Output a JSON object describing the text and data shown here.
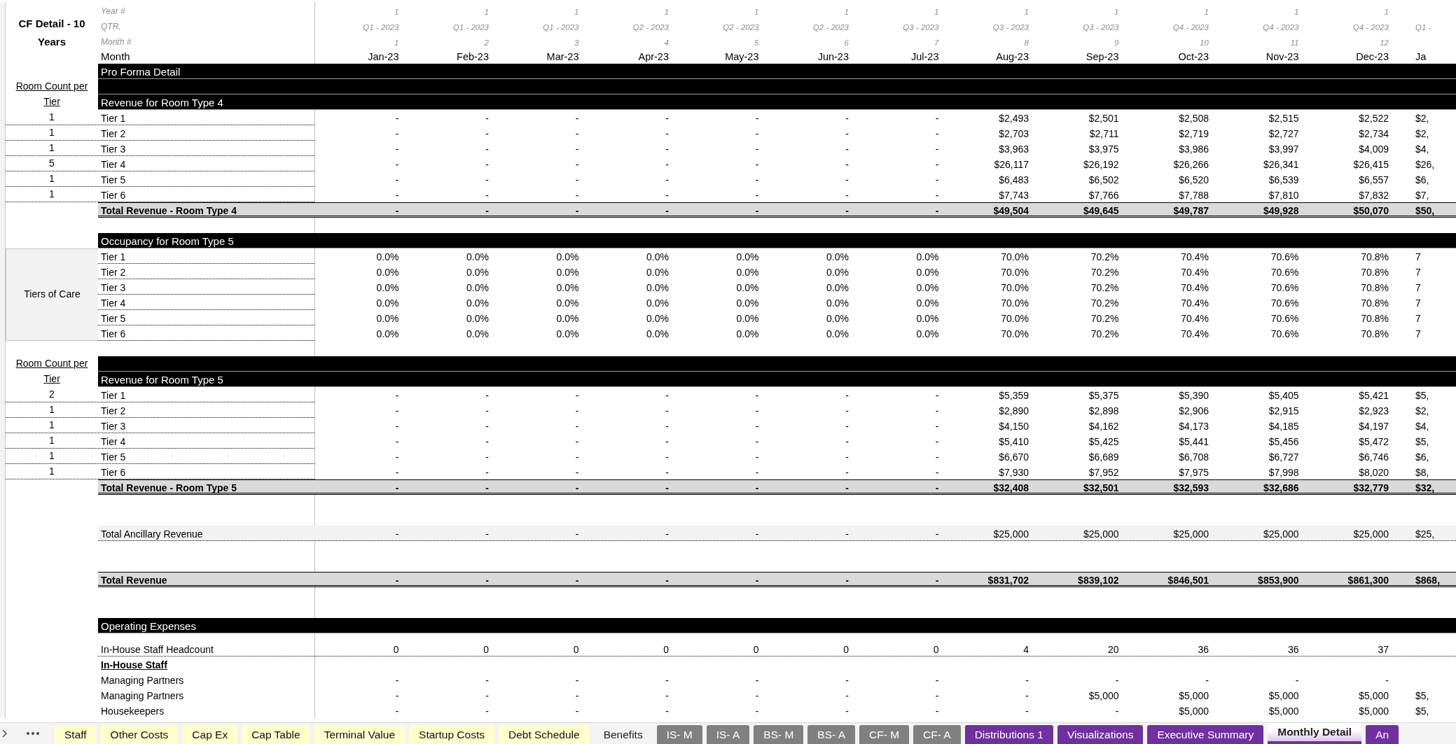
{
  "sheet": {
    "rows": [
      {
        "kind": "meta",
        "side": {
          "kind": "title",
          "text": "CF Detail - 10 Years"
        },
        "label": "Year #",
        "values": [
          "1",
          "1",
          "1",
          "1",
          "1",
          "1",
          "1",
          "1",
          "1",
          "1",
          "1",
          "1"
        ]
      },
      {
        "kind": "meta",
        "label": "QTR.",
        "values": [
          "Q1 - 2023",
          "Q1 - 2023",
          "Q1 - 2023",
          "Q2 - 2023",
          "Q2 - 2023",
          "Q2 - 2023",
          "Q3 - 2023",
          "Q3 - 2023",
          "Q3 - 2023",
          "Q4 - 2023",
          "Q4 - 2023",
          "Q4 - 2023",
          "Q1 -"
        ]
      },
      {
        "kind": "meta",
        "label": "Month #",
        "values": [
          "1",
          "2",
          "3",
          "4",
          "5",
          "6",
          "7",
          "8",
          "9",
          "10",
          "11",
          "12"
        ]
      },
      {
        "kind": "month",
        "label": "Month",
        "values": [
          "Jan-23",
          "Feb-23",
          "Mar-23",
          "Apr-23",
          "May-23",
          "Jun-23",
          "Jul-23",
          "Aug-23",
          "Sep-23",
          "Oct-23",
          "Nov-23",
          "Dec-23",
          "Ja"
        ]
      },
      {
        "kind": "band",
        "label": "Pro Forma Detail"
      },
      {
        "kind": "band",
        "side": {
          "kind": "heading",
          "text": "Room Count per Tier"
        }
      },
      {
        "kind": "band",
        "label": "Revenue for Room Type 4"
      },
      {
        "kind": "item",
        "side": {
          "kind": "count",
          "text": "1"
        },
        "label": "Tier 1",
        "values": [
          "-",
          "-",
          "-",
          "-",
          "-",
          "-",
          "-",
          "$2,493",
          "$2,501",
          "$2,508",
          "$2,515",
          "$2,522",
          "$2,"
        ]
      },
      {
        "kind": "item",
        "side": {
          "kind": "count",
          "text": "1"
        },
        "label": "Tier 2",
        "values": [
          "-",
          "-",
          "-",
          "-",
          "-",
          "-",
          "-",
          "$2,703",
          "$2,711",
          "$2,719",
          "$2,727",
          "$2,734",
          "$2,"
        ]
      },
      {
        "kind": "item",
        "side": {
          "kind": "count",
          "text": "1"
        },
        "label": "Tier 3",
        "values": [
          "-",
          "-",
          "-",
          "-",
          "-",
          "-",
          "-",
          "$3,963",
          "$3,975",
          "$3,986",
          "$3,997",
          "$4,009",
          "$4,"
        ]
      },
      {
        "kind": "item",
        "side": {
          "kind": "count",
          "text": "5"
        },
        "label": "Tier 4",
        "values": [
          "-",
          "-",
          "-",
          "-",
          "-",
          "-",
          "-",
          "$26,117",
          "$26,192",
          "$26,266",
          "$26,341",
          "$26,415",
          "$26,"
        ]
      },
      {
        "kind": "item",
        "side": {
          "kind": "count",
          "text": "1"
        },
        "label": "Tier 5",
        "values": [
          "-",
          "-",
          "-",
          "-",
          "-",
          "-",
          "-",
          "$6,483",
          "$6,502",
          "$6,520",
          "$6,539",
          "$6,557",
          "$6,"
        ]
      },
      {
        "kind": "item",
        "side": {
          "kind": "count",
          "text": "1"
        },
        "label": "Tier 6",
        "values": [
          "-",
          "-",
          "-",
          "-",
          "-",
          "-",
          "-",
          "$7,743",
          "$7,766",
          "$7,788",
          "$7,810",
          "$7,832",
          "$7,"
        ]
      },
      {
        "kind": "total",
        "label": "Total Revenue - Room Type 4",
        "values": [
          "-",
          "-",
          "-",
          "-",
          "-",
          "-",
          "-",
          "$49,504",
          "$49,645",
          "$49,787",
          "$49,928",
          "$50,070",
          "$50,"
        ]
      },
      {
        "kind": "blank"
      },
      {
        "kind": "band",
        "label": "Occupancy for Room Type 5"
      },
      {
        "kind": "item",
        "side": {
          "kind": "group",
          "text": "Tiers of Care"
        },
        "label": "Tier 1",
        "values": [
          "0.0%",
          "0.0%",
          "0.0%",
          "0.0%",
          "0.0%",
          "0.0%",
          "0.0%",
          "70.0%",
          "70.2%",
          "70.4%",
          "70.6%",
          "70.8%",
          "7"
        ]
      },
      {
        "kind": "item",
        "label": "Tier 2",
        "values": [
          "0.0%",
          "0.0%",
          "0.0%",
          "0.0%",
          "0.0%",
          "0.0%",
          "0.0%",
          "70.0%",
          "70.2%",
          "70.4%",
          "70.6%",
          "70.8%",
          "7"
        ]
      },
      {
        "kind": "item",
        "label": "Tier 3",
        "values": [
          "0.0%",
          "0.0%",
          "0.0%",
          "0.0%",
          "0.0%",
          "0.0%",
          "0.0%",
          "70.0%",
          "70.2%",
          "70.4%",
          "70.6%",
          "70.8%",
          "7"
        ]
      },
      {
        "kind": "item",
        "label": "Tier 4",
        "values": [
          "0.0%",
          "0.0%",
          "0.0%",
          "0.0%",
          "0.0%",
          "0.0%",
          "0.0%",
          "70.0%",
          "70.2%",
          "70.4%",
          "70.6%",
          "70.8%",
          "7"
        ]
      },
      {
        "kind": "item",
        "label": "Tier 5",
        "values": [
          "0.0%",
          "0.0%",
          "0.0%",
          "0.0%",
          "0.0%",
          "0.0%",
          "0.0%",
          "70.0%",
          "70.2%",
          "70.4%",
          "70.6%",
          "70.8%",
          "7"
        ]
      },
      {
        "kind": "item",
        "label": "Tier 6",
        "values": [
          "0.0%",
          "0.0%",
          "0.0%",
          "0.0%",
          "0.0%",
          "0.0%",
          "0.0%",
          "70.0%",
          "70.2%",
          "70.4%",
          "70.6%",
          "70.8%",
          "7"
        ]
      },
      {
        "kind": "blank"
      },
      {
        "kind": "band",
        "side": {
          "kind": "heading",
          "text": "Room Count per Tier"
        }
      },
      {
        "kind": "band",
        "label": "Revenue for Room Type 5"
      },
      {
        "kind": "item",
        "side": {
          "kind": "count",
          "text": "2"
        },
        "label": "Tier 1",
        "values": [
          "-",
          "-",
          "-",
          "-",
          "-",
          "-",
          "-",
          "$5,359",
          "$5,375",
          "$5,390",
          "$5,405",
          "$5,421",
          "$5,"
        ]
      },
      {
        "kind": "item",
        "side": {
          "kind": "count",
          "text": "1"
        },
        "label": "Tier 2",
        "values": [
          "-",
          "-",
          "-",
          "-",
          "-",
          "-",
          "-",
          "$2,890",
          "$2,898",
          "$2,906",
          "$2,915",
          "$2,923",
          "$2,"
        ]
      },
      {
        "kind": "item",
        "side": {
          "kind": "count",
          "text": "1"
        },
        "label": "Tier 3",
        "values": [
          "-",
          "-",
          "-",
          "-",
          "-",
          "-",
          "-",
          "$4,150",
          "$4,162",
          "$4,173",
          "$4,185",
          "$4,197",
          "$4,"
        ]
      },
      {
        "kind": "item",
        "side": {
          "kind": "count",
          "text": "1"
        },
        "label": "Tier 4",
        "values": [
          "-",
          "-",
          "-",
          "-",
          "-",
          "-",
          "-",
          "$5,410",
          "$5,425",
          "$5,441",
          "$5,456",
          "$5,472",
          "$5,"
        ]
      },
      {
        "kind": "item",
        "side": {
          "kind": "count",
          "text": "1"
        },
        "label": "Tier 5",
        "values": [
          "-",
          "-",
          "-",
          "-",
          "-",
          "-",
          "-",
          "$6,670",
          "$6,689",
          "$6,708",
          "$6,727",
          "$6,746",
          "$6,"
        ]
      },
      {
        "kind": "item",
        "side": {
          "kind": "count",
          "text": "1"
        },
        "label": "Tier 6",
        "values": [
          "-",
          "-",
          "-",
          "-",
          "-",
          "-",
          "-",
          "$7,930",
          "$7,952",
          "$7,975",
          "$7,998",
          "$8,020",
          "$8,"
        ]
      },
      {
        "kind": "total",
        "label": "Total Revenue - Room Type 5",
        "values": [
          "-",
          "-",
          "-",
          "-",
          "-",
          "-",
          "-",
          "$32,408",
          "$32,501",
          "$32,593",
          "$32,686",
          "$32,779",
          "$32,"
        ]
      },
      {
        "kind": "blank"
      },
      {
        "kind": "blank"
      },
      {
        "kind": "shaded",
        "label": "Total Ancillary Revenue",
        "values": [
          "-",
          "-",
          "-",
          "-",
          "-",
          "-",
          "-",
          "$25,000",
          "$25,000",
          "$25,000",
          "$25,000",
          "$25,000",
          "$25,"
        ]
      },
      {
        "kind": "blank"
      },
      {
        "kind": "blank"
      },
      {
        "kind": "total",
        "label": "Total Revenue",
        "values": [
          "-",
          "-",
          "-",
          "-",
          "-",
          "-",
          "-",
          "$831,702",
          "$839,102",
          "$846,501",
          "$853,900",
          "$861,300",
          "$868,"
        ]
      },
      {
        "kind": "blank"
      },
      {
        "kind": "blank"
      },
      {
        "kind": "band",
        "label": "Operating Expenses"
      },
      {
        "kind": "spacer"
      },
      {
        "kind": "count",
        "label": "In-House Staff Headcount",
        "values": [
          "0",
          "0",
          "0",
          "0",
          "0",
          "0",
          "0",
          "4",
          "20",
          "36",
          "36",
          "37"
        ]
      },
      {
        "kind": "subheading",
        "label": "In-House Staff"
      },
      {
        "kind": "item_plain",
        "label": "Managing Partners",
        "values": [
          "-",
          "-",
          "-",
          "-",
          "-",
          "-",
          "-",
          "-",
          "-",
          "-",
          "-",
          "-"
        ]
      },
      {
        "kind": "item_plain",
        "label": "Managing Partners",
        "values": [
          "-",
          "-",
          "-",
          "-",
          "-",
          "-",
          "-",
          "-",
          "$5,000",
          "$5,000",
          "$5,000",
          "$5,000",
          "$5,"
        ]
      },
      {
        "kind": "item_plain",
        "label": "Housekeepers",
        "values": [
          "-",
          "-",
          "-",
          "-",
          "-",
          "-",
          "-",
          "-",
          "-",
          "$5,000",
          "$5,000",
          "$5,000",
          "$5,"
        ]
      }
    ]
  },
  "tabs": [
    {
      "label": "Staff",
      "color": "#ffffcc",
      "selected": false
    },
    {
      "label": "Other Costs",
      "color": "#ffffcc",
      "selected": false
    },
    {
      "label": "Cap Ex",
      "color": "#ffffcc",
      "selected": false
    },
    {
      "label": "Cap Table",
      "color": "#ffffcc",
      "selected": false
    },
    {
      "label": "Terminal Value",
      "color": "#ffffcc",
      "selected": false
    },
    {
      "label": "Startup Costs",
      "color": "#ffffcc",
      "selected": false
    },
    {
      "label": "Debt Schedule",
      "color": "#ffffcc",
      "selected": false
    },
    {
      "label": "Benefits",
      "selected": false
    },
    {
      "label": "IS- M",
      "color": "#808080",
      "selected": false
    },
    {
      "label": "IS- A",
      "color": "#808080",
      "selected": false
    },
    {
      "label": "BS- M",
      "color": "#808080",
      "selected": false
    },
    {
      "label": "BS- A",
      "color": "#808080",
      "selected": false
    },
    {
      "label": "CF- M",
      "color": "#808080",
      "selected": false
    },
    {
      "label": "CF- A",
      "color": "#808080",
      "selected": false
    },
    {
      "label": "Distributions 1",
      "color": "#7030a0",
      "selected": false
    },
    {
      "label": "Visualizations",
      "color": "#7030a0",
      "selected": false
    },
    {
      "label": "Executive Summary",
      "color": "#7030a0",
      "selected": false
    },
    {
      "label": "Monthly Detail",
      "color": "#7030a0",
      "selected": true
    },
    {
      "label": "An",
      "color": "#7030a0",
      "selected": false
    }
  ]
}
